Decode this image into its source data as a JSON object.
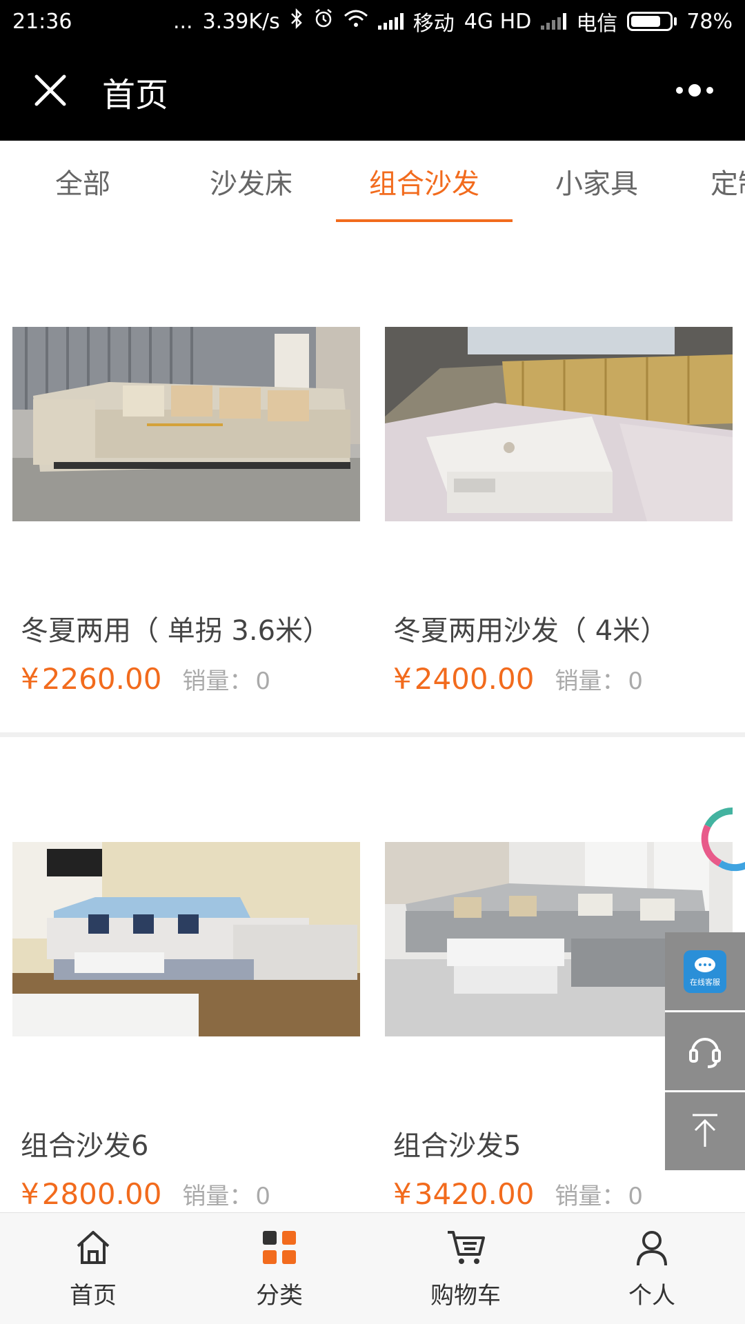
{
  "status_bar": {
    "time": "21:36",
    "dots": "...",
    "speed": "3.39K/s",
    "carrier1": "移动",
    "network": "4G HD",
    "carrier2": "电信",
    "battery": "78%",
    "battery_level": 0.78
  },
  "title_bar": {
    "title": "首页",
    "close_icon": "close-icon",
    "more_icon": "more-icon"
  },
  "tabs": [
    {
      "label": "全部",
      "active": false
    },
    {
      "label": "沙发床",
      "active": false
    },
    {
      "label": "组合沙发",
      "active": true
    },
    {
      "label": "小家具",
      "active": false
    },
    {
      "label": "定制",
      "active": false
    }
  ],
  "products": [
    {
      "name": "冬夏两用（ 单拐 3.6米）",
      "price_symbol": "¥",
      "price": "2260.00",
      "sales_label": "销量：",
      "sales": "0"
    },
    {
      "name": "冬夏两用沙发（ 4米）",
      "price_symbol": "¥",
      "price": "2400.00",
      "sales_label": "销量：",
      "sales": "0"
    },
    {
      "name": "组合沙发6",
      "price_symbol": "¥",
      "price": "2800.00",
      "sales_label": "销量：",
      "sales": "0"
    },
    {
      "name": "组合沙发5",
      "price_symbol": "¥",
      "price": "3420.00",
      "sales_label": "销量：",
      "sales": "0"
    }
  ],
  "side_buttons": {
    "customer_service_badge": "在线客服",
    "icons": [
      "customer-service-icon",
      "headset-icon",
      "back-to-top-icon"
    ]
  },
  "bottom_nav": [
    {
      "label": "首页",
      "icon": "home-icon"
    },
    {
      "label": "分类",
      "icon": "category-icon"
    },
    {
      "label": "购物车",
      "icon": "cart-icon"
    },
    {
      "label": "个人",
      "icon": "person-icon"
    }
  ],
  "colors": {
    "accent": "#f26b1d",
    "header_bg": "#000000",
    "side_button_bg": "#8c8c8c"
  }
}
